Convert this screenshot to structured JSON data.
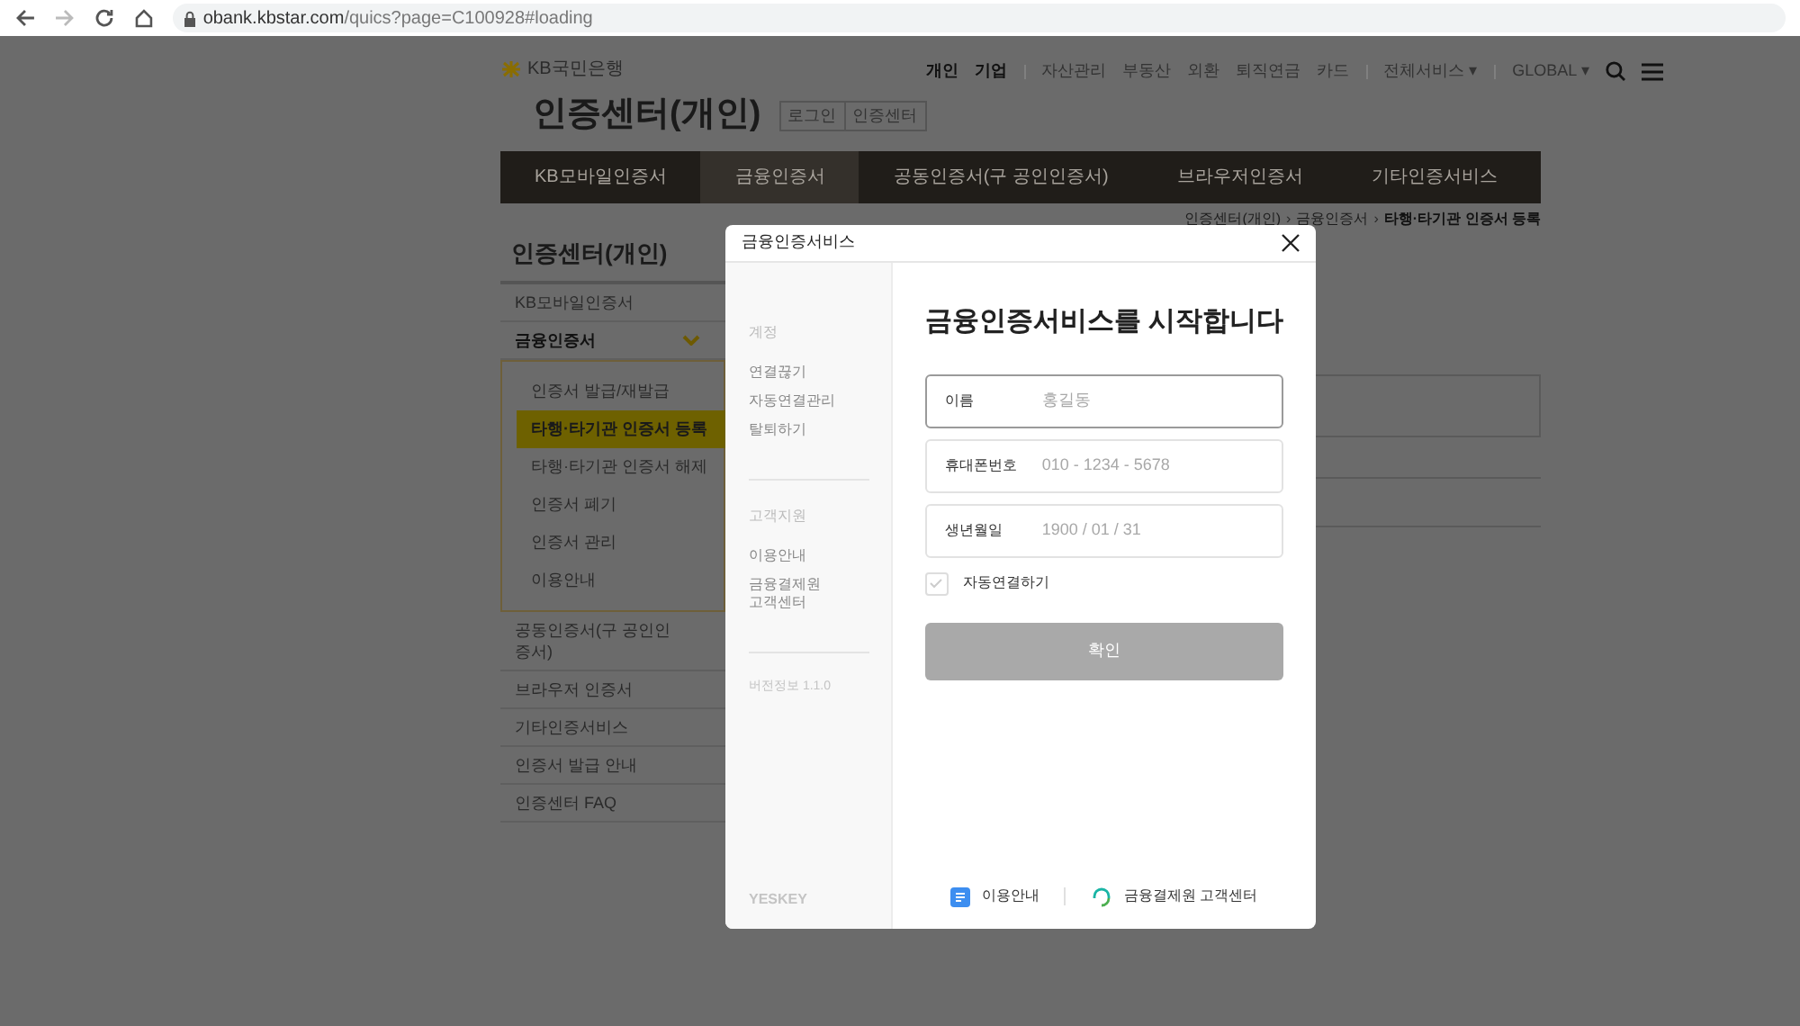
{
  "browser": {
    "url_host": "obank.kbstar.com",
    "url_path": "/quics?page=C100928#loading"
  },
  "header": {
    "bank_name": "KB국민은행",
    "site_title": "인증센터(개인)",
    "quick_buttons": [
      "로그인",
      "인증센터"
    ],
    "top_links": [
      {
        "label": "개인",
        "bold": true,
        "divider_before": false
      },
      {
        "label": "기업",
        "bold": true,
        "divider_before": false
      },
      {
        "label": "자산관리",
        "bold": false,
        "divider_before": true
      },
      {
        "label": "부동산",
        "bold": false,
        "divider_before": false
      },
      {
        "label": "외환",
        "bold": false,
        "divider_before": false
      },
      {
        "label": "퇴직연금",
        "bold": false,
        "divider_before": false
      },
      {
        "label": "카드",
        "bold": false,
        "divider_before": false
      },
      {
        "label": "전체서비스",
        "caret": "▾",
        "bold": false,
        "divider_before": true
      },
      {
        "label": "GLOBAL",
        "caret": "▾",
        "bold": false,
        "divider_before": true
      }
    ]
  },
  "nav_tabs": [
    {
      "label": "KB모바일인증서",
      "selected": false
    },
    {
      "label": "금융인증서",
      "selected": true
    },
    {
      "label": "공동인증서(구 공인인증서)",
      "selected": false
    },
    {
      "label": "브라우저인증서",
      "selected": false
    },
    {
      "label": "기타인증서비스",
      "selected": false
    }
  ],
  "breadcrumb": [
    {
      "label": "인증센터(개인)",
      "current": false
    },
    {
      "separator_before": "›",
      "label": "금융인증서",
      "current": false
    },
    {
      "separator_before": "›",
      "label": "타행·타기관 인증서 등록",
      "current": true
    }
  ],
  "sidebar": {
    "title": "인증센터(개인)",
    "items": [
      {
        "label": "KB모바일인증서",
        "expanded": false
      },
      {
        "label": "금융인증서",
        "expanded": true,
        "children": [
          {
            "label": "인증서 발급/재발급",
            "selected": false
          },
          {
            "label": "타행·타기관 인증서 등록",
            "selected": true
          },
          {
            "label": "타행·타기관 인증서 해제",
            "selected": false
          },
          {
            "label": "인증서 폐기",
            "selected": false
          },
          {
            "label": "인증서 관리",
            "selected": false
          },
          {
            "label": "이용안내",
            "selected": false
          }
        ]
      },
      {
        "label": "공동인증서(구 공인인증서)",
        "expanded": false
      },
      {
        "label": "브라우저 인증서",
        "expanded": false
      },
      {
        "label": "기타인증서비스",
        "expanded": false
      },
      {
        "label": "인증서 발급 안내",
        "expanded": false
      },
      {
        "label": "인증센터 FAQ",
        "expanded": false
      }
    ]
  },
  "modal": {
    "title": "금융인증서비스",
    "side_menu": [
      {
        "heading": "계정",
        "items": [
          "연결끊기",
          "자동연결관리",
          "탈퇴하기"
        ]
      },
      {
        "heading": "고객지원",
        "items": [
          "이용안내",
          "금융결제원 고객센터"
        ]
      }
    ],
    "version": "버전정보 1.1.0",
    "brand": "YESKEY",
    "heading": "금융인증서비스를 시작합니다",
    "fields": [
      {
        "label": "이름",
        "placeholder": "홍길동",
        "focused": true
      },
      {
        "label": "휴대폰번호",
        "placeholder": "010 - 1234 - 5678",
        "focused": false
      },
      {
        "label": "생년월일",
        "placeholder": "1900 / 01 / 31",
        "focused": false
      }
    ],
    "auto_connect": {
      "label": "자동연결하기",
      "checked": false
    },
    "confirm": {
      "label": "확인",
      "disabled": true
    },
    "footer_links": [
      {
        "kind": "guide",
        "label": "이용안내"
      },
      {
        "kind": "support",
        "label": "금융결제원 고객센터"
      }
    ]
  }
}
